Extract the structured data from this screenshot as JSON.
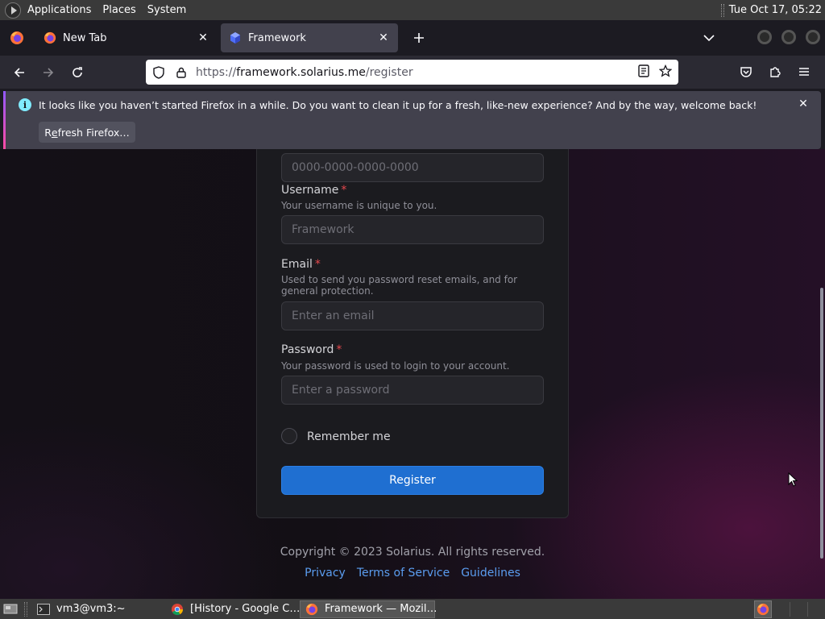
{
  "top_panel": {
    "menus": [
      "Applications",
      "Places",
      "System"
    ],
    "clock": "Tue Oct 17, 05:22"
  },
  "tabs": [
    {
      "title": "New Tab"
    },
    {
      "title": "Framework",
      "active": true
    }
  ],
  "url": {
    "scheme": "https://",
    "host": "framework.solarius.me",
    "path": "/register"
  },
  "notification": {
    "text": "It looks like you haven’t started Firefox in a while. Do you want to clean it up for a fresh, like-new experience? And by the way, welcome back!",
    "button_first": "R",
    "button_underlined": "e",
    "button_rest": "fresh Firefox…"
  },
  "form": {
    "code_placeholder": "0000-0000-0000-0000",
    "username": {
      "label": "Username",
      "hint": "Your username is unique to you.",
      "placeholder": "Framework"
    },
    "email": {
      "label": "Email",
      "hint": "Used to send you password reset emails, and for general protection.",
      "placeholder": "Enter an email"
    },
    "password": {
      "label": "Password",
      "hint": "Your password is used to login to your account.",
      "placeholder": "Enter a password"
    },
    "required_marker": "*",
    "remember_label": "Remember me",
    "submit_label": "Register"
  },
  "footer": {
    "copyright": "Copyright © 2023 Solarius. All rights reserved.",
    "links": [
      "Privacy",
      "Terms of Service",
      "Guidelines"
    ]
  },
  "taskbar": {
    "items": [
      {
        "label": "vm3@vm3:~",
        "icon": "terminal-icon"
      },
      {
        "label": "[History - Google C…",
        "icon": "chrome-icon"
      },
      {
        "label": "Framework — Mozil…",
        "icon": "firefox-icon",
        "active": true
      }
    ]
  },
  "colors": {
    "accent": "#1f6fd1",
    "link": "#5b9df0",
    "required": "#e5484d",
    "notification_bg": "#42414d"
  }
}
